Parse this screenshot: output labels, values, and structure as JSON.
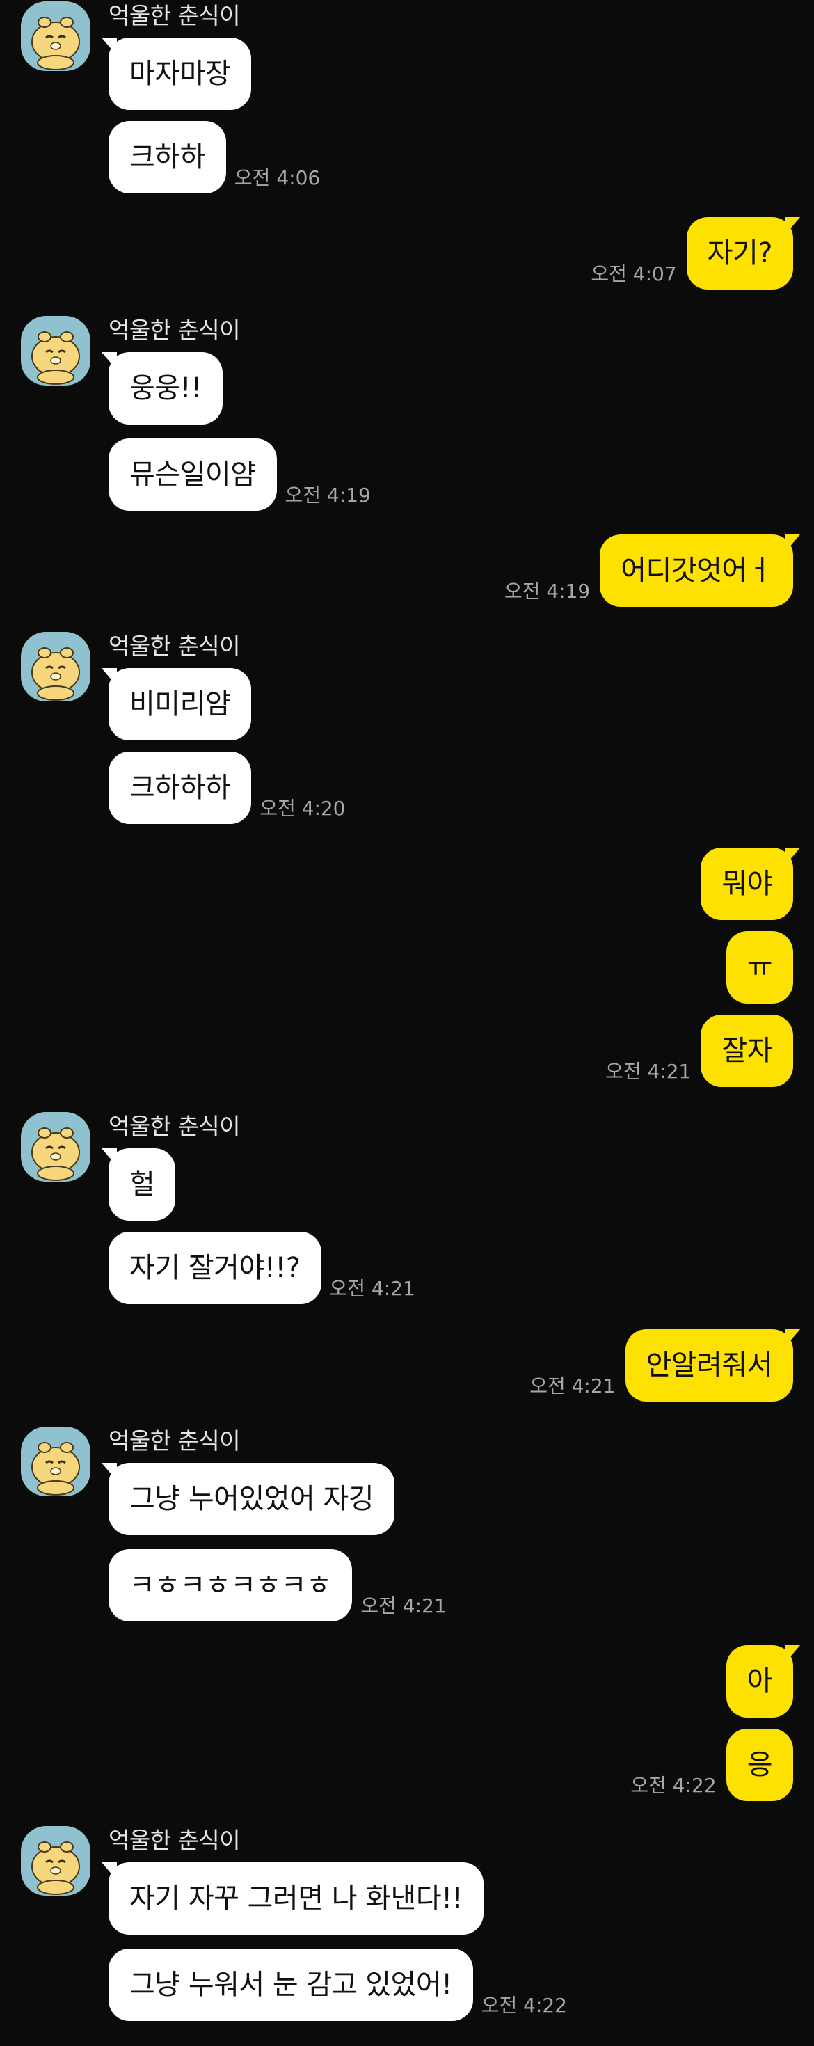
{
  "sender_name": "억울한 춘식이",
  "groups": [
    {
      "dir": "in",
      "show_sender": true,
      "messages": [
        "마자마장",
        "크하하"
      ],
      "time": "오전 4:06"
    },
    {
      "dir": "out",
      "messages": [
        "자기?"
      ],
      "time": "오전 4:07"
    },
    {
      "dir": "in",
      "show_sender": true,
      "messages": [
        "웅웅!!",
        "뮤슨일이얌"
      ],
      "time": "오전 4:19"
    },
    {
      "dir": "out",
      "messages": [
        "어디갓엇어ㅓ"
      ],
      "time": "오전 4:19"
    },
    {
      "dir": "in",
      "show_sender": true,
      "messages": [
        "비미리얌",
        "크하하하"
      ],
      "time": "오전 4:20"
    },
    {
      "dir": "out",
      "messages": [
        "뭐야",
        "ㅠ",
        "잘자"
      ],
      "time": "오전 4:21"
    },
    {
      "dir": "in",
      "show_sender": true,
      "messages": [
        "헐",
        "자기 잘거야!!?"
      ],
      "time": "오전 4:21"
    },
    {
      "dir": "out",
      "messages": [
        "안알려줘서"
      ],
      "time": "오전 4:21"
    },
    {
      "dir": "in",
      "show_sender": true,
      "messages": [
        "그냥 누어있었어 자깅",
        "ㅋㅎㅋㅎㅋㅎㅋㅎ"
      ],
      "time": "오전 4:21"
    },
    {
      "dir": "out",
      "messages": [
        "아",
        "응"
      ],
      "time": "오전 4:22"
    },
    {
      "dir": "in",
      "show_sender": true,
      "messages": [
        "자기 자꾸 그러면 나 화낸다!!",
        "그냥 누워서 눈 감고 있었어!"
      ],
      "time": "오전 4:22"
    }
  ],
  "colors": {
    "background": "#0b0b0b",
    "incoming_bubble": "#ffffff",
    "outgoing_bubble": "#fde100",
    "timestamp": "#a7a7a7"
  },
  "icons": {
    "avatar": "chunsik-character-avatar"
  }
}
